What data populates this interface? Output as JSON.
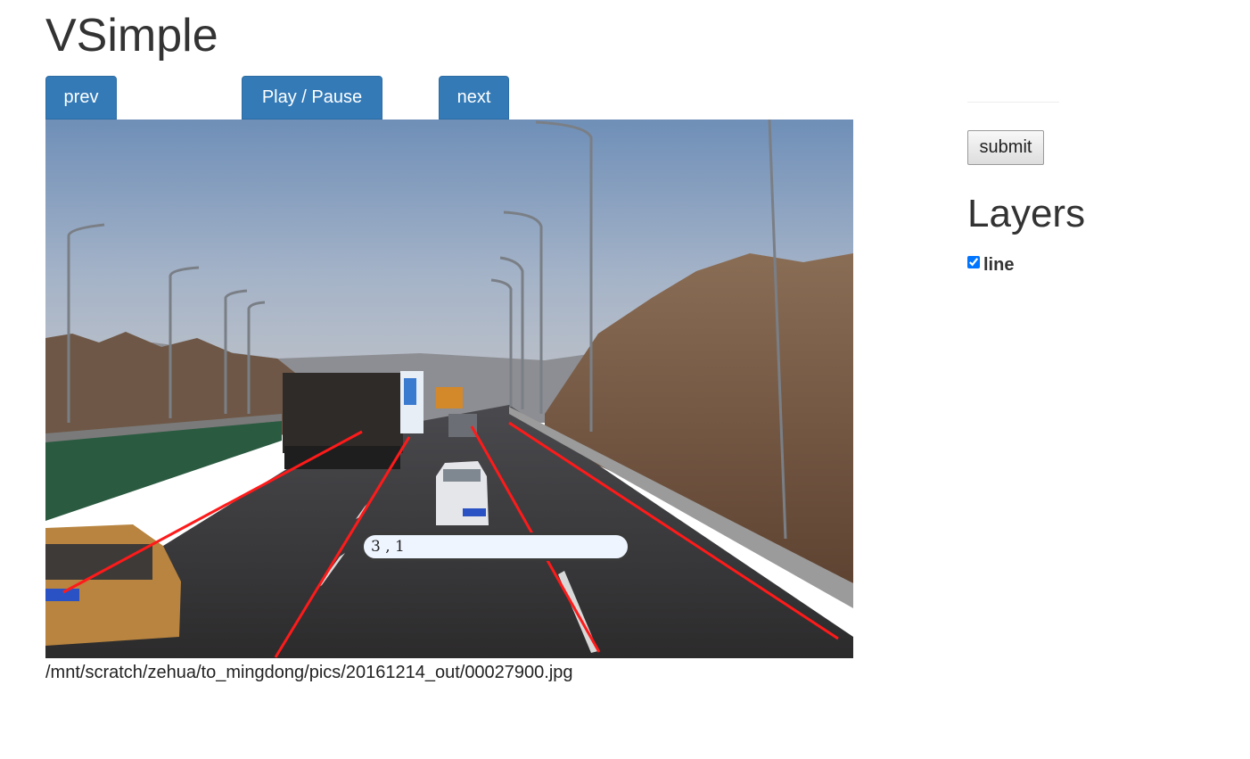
{
  "app": {
    "title": "VSimple"
  },
  "controls": {
    "prev_label": "prev",
    "play_label": "Play / Pause",
    "next_label": "next"
  },
  "viewer": {
    "coord_value": "3 , 1",
    "file_path": "/mnt/scratch/zehua/to_mingdong/pics/20161214_out/00027900.jpg",
    "annotation_color": "#ff1a1a"
  },
  "sidebar": {
    "submit_label": "submit",
    "layers_title": "Layers",
    "layers": [
      {
        "label": "line",
        "checked": true
      }
    ]
  },
  "colors": {
    "accent": "#337ab7"
  }
}
